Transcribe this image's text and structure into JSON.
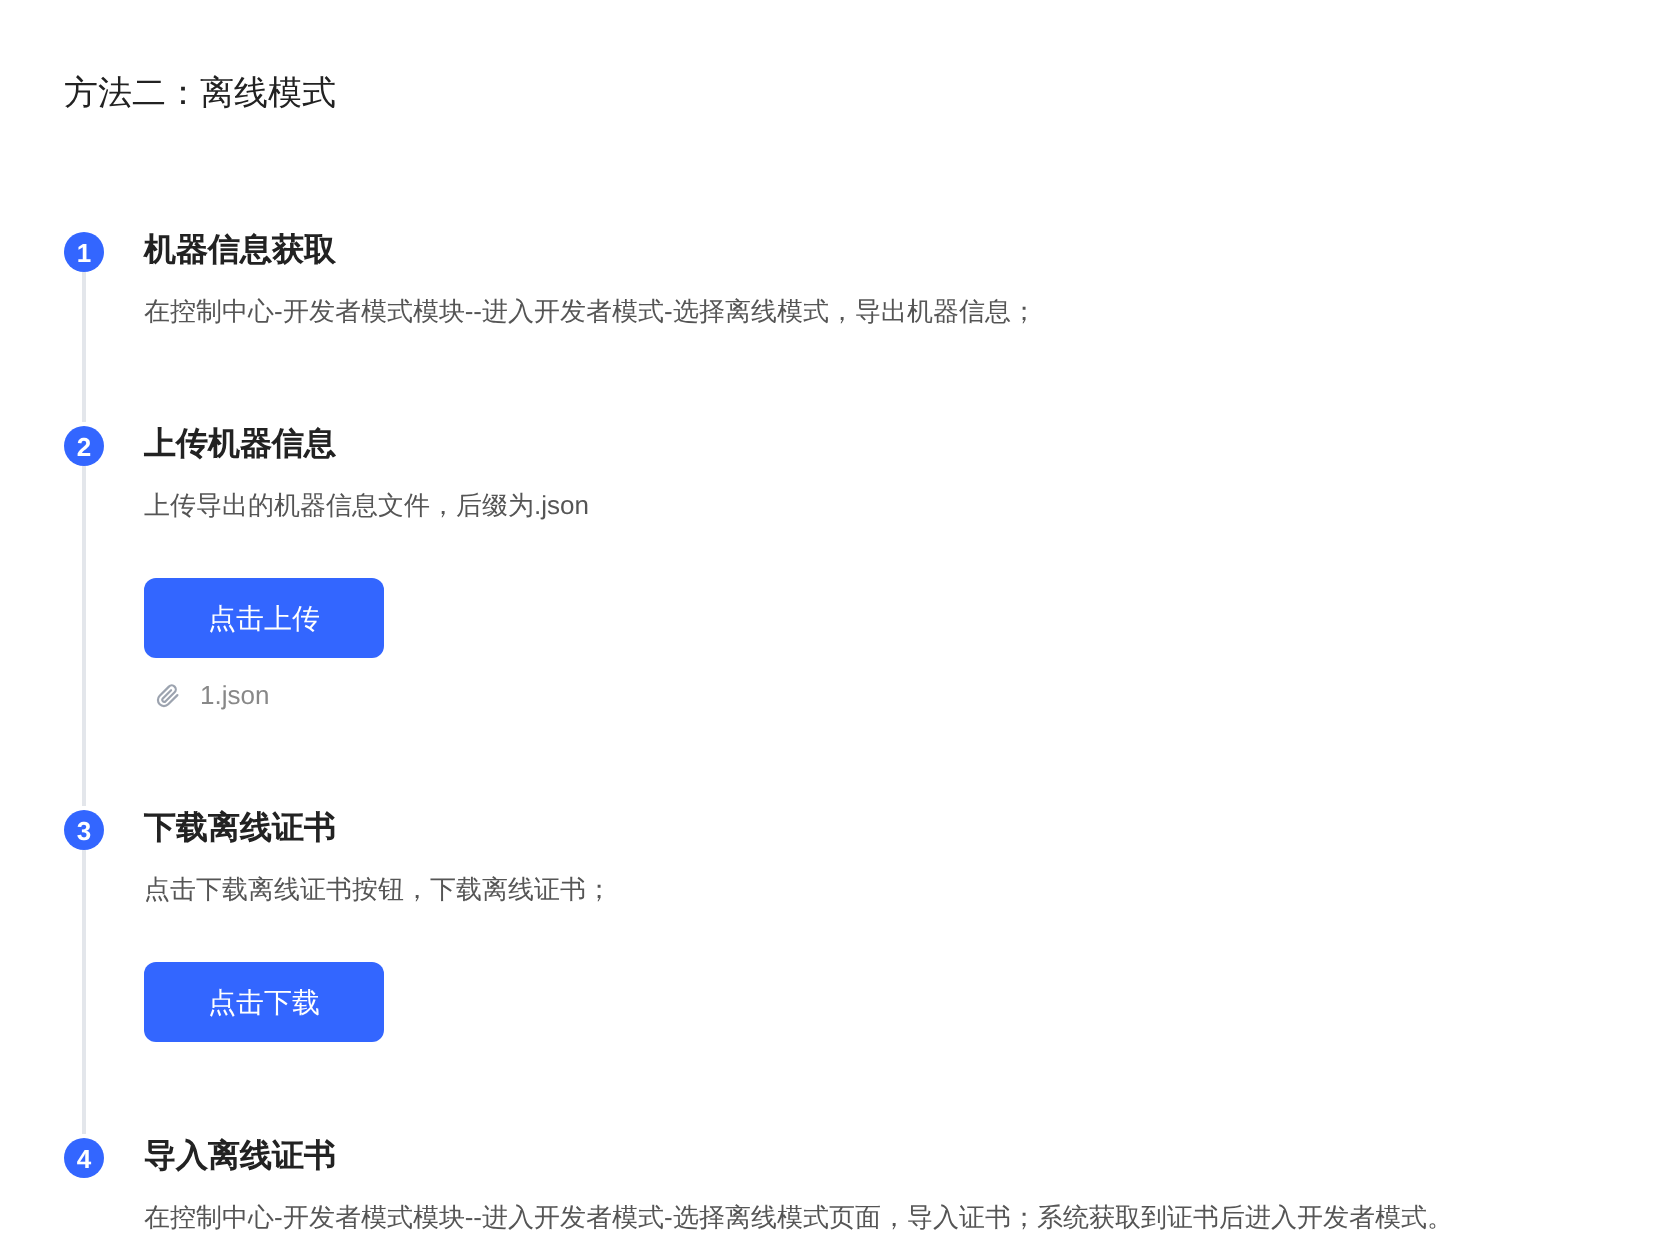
{
  "title": "方法二：离线模式",
  "steps": [
    {
      "number": "1",
      "title": "机器信息获取",
      "description": "在控制中心-开发者模式模块--进入开发者模式-选择离线模式，导出机器信息；"
    },
    {
      "number": "2",
      "title": "上传机器信息",
      "description": "上传导出的机器信息文件，后缀为.json",
      "button": "点击上传",
      "file": "1.json"
    },
    {
      "number": "3",
      "title": "下载离线证书",
      "description": "点击下载离线证书按钮，下载离线证书；",
      "button": "点击下载"
    },
    {
      "number": "4",
      "title": "导入离线证书",
      "description": "在控制中心-开发者模式模块--进入开发者模式-选择离线模式页面，导入证书；系统获取到证书后进入开发者模式。"
    }
  ]
}
